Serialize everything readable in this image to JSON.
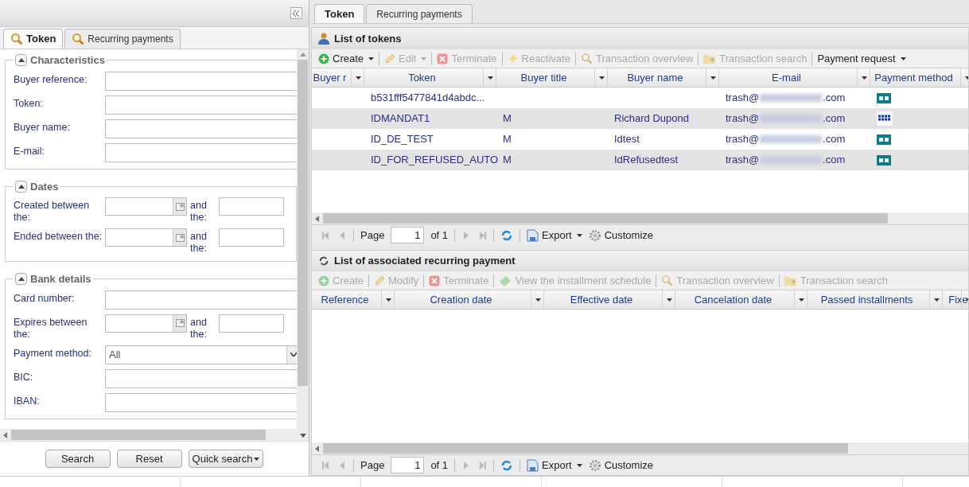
{
  "left_panel": {
    "tabs": [
      {
        "label": "Token",
        "selected": true
      },
      {
        "label": "Recurring payments",
        "selected": false
      }
    ],
    "sections": [
      {
        "title": "Characteristics",
        "expanded": true,
        "fields": [
          {
            "kind": "text",
            "label": "Buyer reference:"
          },
          {
            "kind": "text",
            "label": "Token:"
          },
          {
            "kind": "text",
            "label": "Buyer name:"
          },
          {
            "kind": "text",
            "label": "E-mail:"
          }
        ]
      },
      {
        "title": "Dates",
        "expanded": true,
        "fields": [
          {
            "kind": "range",
            "label": "Created between the:",
            "and": "and the:"
          },
          {
            "kind": "range",
            "label": "Ended between the:",
            "and": "and the:"
          }
        ]
      },
      {
        "title": "Bank details",
        "expanded": true,
        "fields": [
          {
            "kind": "text",
            "label": "Card number:"
          },
          {
            "kind": "range",
            "label": "Expires between the:",
            "and": "and the:"
          },
          {
            "kind": "select",
            "label": "Payment method:",
            "value": "All"
          },
          {
            "kind": "text",
            "label": "BIC:"
          },
          {
            "kind": "text",
            "label": "IBAN:"
          }
        ]
      }
    ],
    "buttons": [
      {
        "label": "Search",
        "menu": false
      },
      {
        "label": "Reset",
        "menu": false
      },
      {
        "label": "Quick search",
        "menu": true
      }
    ]
  },
  "right_panel": {
    "tabs": [
      {
        "label": "Token",
        "selected": true
      },
      {
        "label": "Recurring payments",
        "selected": false
      }
    ],
    "tokens": {
      "title": "List of tokens",
      "toolbar": [
        {
          "label": "Create",
          "kind": "plus",
          "disabled": false,
          "menu": true
        },
        {
          "label": "Edit",
          "kind": "pencil",
          "disabled": true,
          "menu": true
        },
        {
          "label": "Terminate",
          "kind": "x",
          "disabled": true,
          "menu": false
        },
        {
          "label": "Reactivate",
          "kind": "bolt",
          "disabled": true,
          "menu": false
        },
        {
          "label": "Transaction overview",
          "kind": "search",
          "disabled": true,
          "menu": false
        },
        {
          "label": "Transaction search",
          "kind": "folder",
          "disabled": true,
          "menu": false
        },
        {
          "label": "Payment request",
          "kind": "plain",
          "disabled": false,
          "menu": true
        }
      ],
      "columns": [
        "Buyer r",
        "Token",
        "Buyer title",
        "Buyer name",
        "E-mail",
        "Payment method"
      ],
      "rows": [
        {
          "buyer_ref": "",
          "token": "b531fff5477841d4abdc...",
          "title": "",
          "name": "",
          "email_start": "trash@",
          "email_end": ".com",
          "kind": "card"
        },
        {
          "buyer_ref": "",
          "token": "IDMANDAT1",
          "title": "M",
          "name": "Richard Dupond",
          "email_start": "trash@",
          "email_end": ".com",
          "kind": "sepa"
        },
        {
          "buyer_ref": "",
          "token": "ID_DE_TEST",
          "title": "M",
          "name": "Idtest",
          "email_start": "trash@",
          "email_end": ".com",
          "kind": "card"
        },
        {
          "buyer_ref": "",
          "token": "ID_FOR_REFUSED_AUTO",
          "title": "M",
          "name": "IdRefusedtest",
          "email_start": "trash@",
          "email_end": ".com",
          "kind": "card"
        }
      ],
      "pager": {
        "page_label": "Page",
        "page": "1",
        "of": "of 1",
        "export": "Export",
        "customize": "Customize"
      }
    },
    "recurring": {
      "title": "List of associated recurring payment",
      "toolbar": [
        {
          "label": "Create",
          "kind": "plus",
          "disabled": true,
          "menu": false
        },
        {
          "label": "Modify",
          "kind": "pencil",
          "disabled": true,
          "menu": false
        },
        {
          "label": "Terminate",
          "kind": "x",
          "disabled": true,
          "menu": false
        },
        {
          "label": "View the installment schedule",
          "kind": "money",
          "disabled": true,
          "menu": false
        },
        {
          "label": "Transaction overview",
          "kind": "search",
          "disabled": true,
          "menu": false
        },
        {
          "label": "Transaction search",
          "kind": "folder",
          "disabled": true,
          "menu": false
        }
      ],
      "columns": [
        "Reference",
        "Creation date",
        "Effective date",
        "Cancelation date",
        "Passed installments",
        "Fixe"
      ],
      "pager": {
        "page_label": "Page",
        "page": "1",
        "of": "of 1",
        "export": "Export",
        "customize": "Customize"
      }
    }
  }
}
